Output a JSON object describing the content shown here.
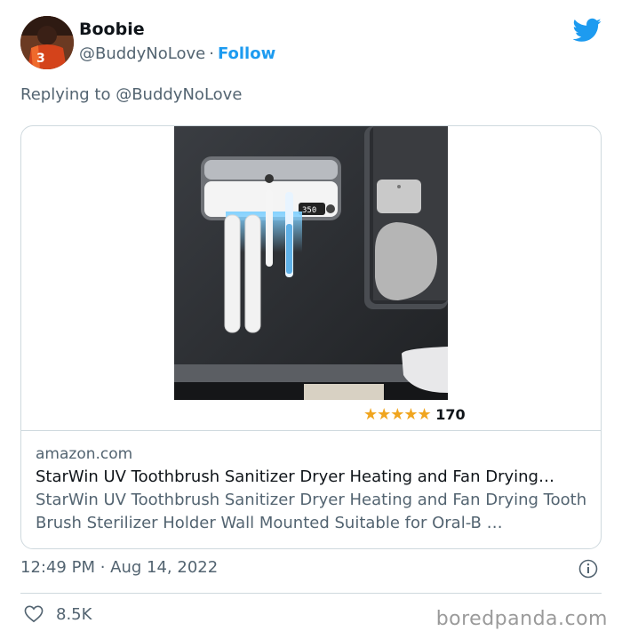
{
  "author": {
    "name": "Boobie",
    "handle": "@BuddyNoLove",
    "separator": "·",
    "follow_label": "Follow"
  },
  "reply_line": "Replying to @BuddyNoLove",
  "card": {
    "rating_stars": "★★★★★",
    "rating_count": "170",
    "domain": "amazon.com",
    "title": "StarWin UV Toothbrush Sanitizer Dryer Heating and Fan Drying…",
    "description": "StarWin UV Toothbrush Sanitizer Dryer Heating and Fan Drying Tooth Brush Sterilizer Holder Wall Mounted Suitable for Oral-B …",
    "display_text": "350"
  },
  "timestamp": "12:49 PM · Aug 14, 2022",
  "likes": "8.5K",
  "watermark": "boredpanda.com",
  "icons": {
    "brand": "twitter-bird-icon",
    "info": "info-icon",
    "like": "heart-icon"
  },
  "colors": {
    "accent": "#1d9bf0",
    "secondary_text": "#536471",
    "border": "#cfd9de",
    "star": "#f0a51f"
  }
}
